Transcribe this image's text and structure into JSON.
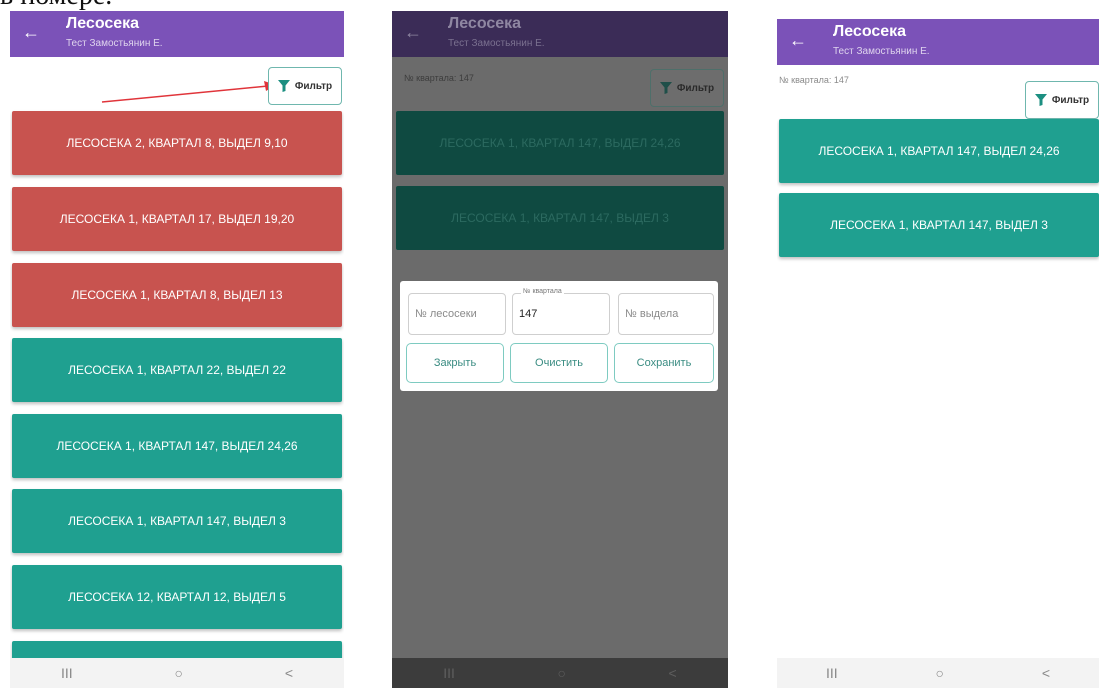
{
  "caption": "в номере.",
  "appbar": {
    "title": "Лесосека",
    "subtitle": "Тест Замостьянин Е."
  },
  "filter_button": {
    "label": "Фильтр",
    "icon": "funnel-icon"
  },
  "filter_summary": "№ квартала: 147",
  "colors": {
    "appbar": "#7b52b8",
    "tile_red": "#c8534f",
    "tile_teal": "#1fa090",
    "arrow": "#e0343a",
    "accent_border": "#6fb7ae"
  },
  "screen1": {
    "items": [
      {
        "label": "ЛЕСОСЕКА 2, КВАРТАЛ 8, ВЫДЕЛ 9,10",
        "status": "red"
      },
      {
        "label": "ЛЕСОСЕКА 1, КВАРТАЛ 17, ВЫДЕЛ 19,20",
        "status": "red"
      },
      {
        "label": "ЛЕСОСЕКА 1, КВАРТАЛ 8, ВЫДЕЛ 13",
        "status": "red"
      },
      {
        "label": "ЛЕСОСЕКА 1, КВАРТАЛ 22, ВЫДЕЛ 22",
        "status": "teal"
      },
      {
        "label": "ЛЕСОСЕКА 1, КВАРТАЛ 147, ВЫДЕЛ 24,26",
        "status": "teal"
      },
      {
        "label": "ЛЕСОСЕКА 1, КВАРТАЛ 147, ВЫДЕЛ 3",
        "status": "teal"
      },
      {
        "label": "ЛЕСОСЕКА 12, КВАРТАЛ 12, ВЫДЕЛ 5",
        "status": "teal"
      }
    ]
  },
  "filtered_items": [
    {
      "label": "ЛЕСОСЕКА 1, КВАРТАЛ 147, ВЫДЕЛ 24,26"
    },
    {
      "label": "ЛЕСОСЕКА 1, КВАРТАЛ 147, ВЫДЕЛ 3"
    }
  ],
  "dialog": {
    "lesoseka_placeholder": "№ лесосеки",
    "kvartal_label": "№ квартала",
    "kvartal_value": "147",
    "vydel_placeholder": "№ выдела",
    "close_label": "Закрыть",
    "clear_label": "Очистить",
    "save_label": "Сохранить"
  },
  "navbar": {
    "recents_icon": "III",
    "home_icon": "○",
    "back_icon": "<"
  }
}
